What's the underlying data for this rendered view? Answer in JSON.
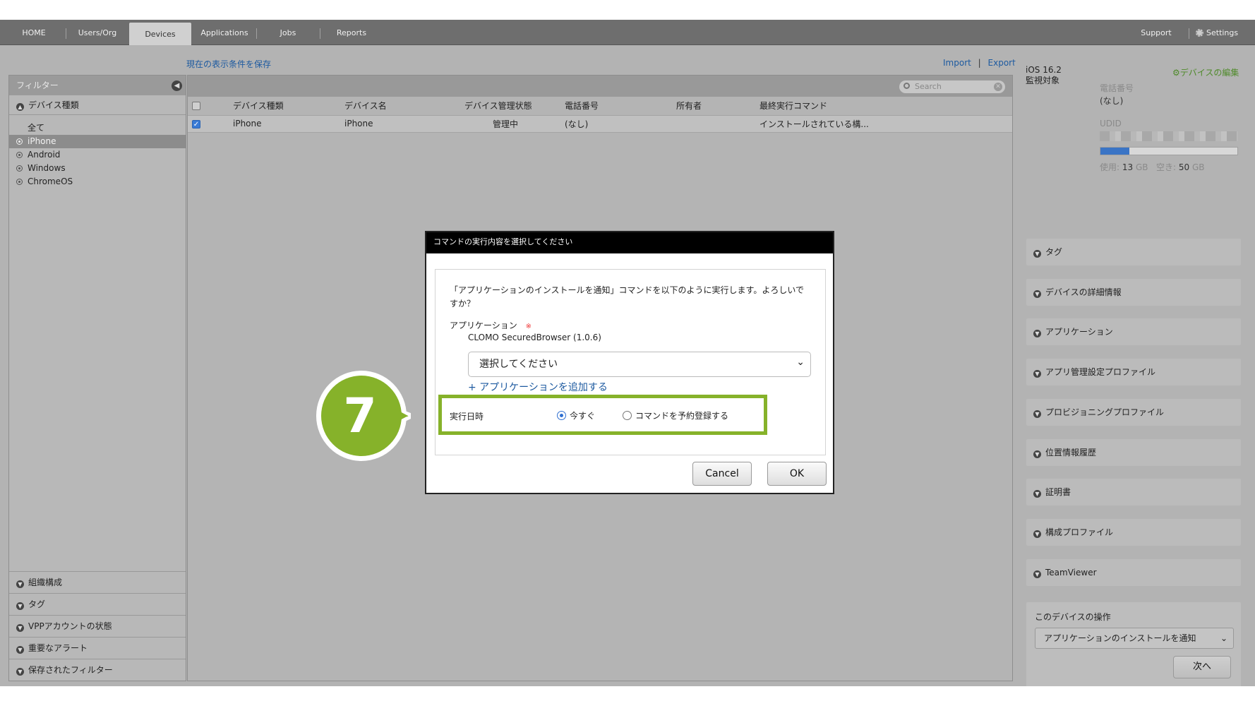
{
  "nav": {
    "tabs": [
      "HOME",
      "Users/Org",
      "Devices",
      "Applications",
      "Jobs",
      "Reports"
    ],
    "active_tab": "Devices",
    "support": "Support",
    "settings": "Settings"
  },
  "subheader": {
    "save_view": "現在の表示条件を保存",
    "import": "Import",
    "separator": "|",
    "export": "Export"
  },
  "sidebar": {
    "title": "フィルター",
    "section_device_type": "デバイス種類",
    "items": [
      "全て",
      "iPhone",
      "Android",
      "Windows",
      "ChromeOS"
    ],
    "selected_item": "iPhone",
    "bottom_sections": [
      "組織構成",
      "タグ",
      "VPPアカウントの状態",
      "重要なアラート",
      "保存されたフィルター"
    ]
  },
  "search": {
    "placeholder": "Search"
  },
  "table": {
    "columns": [
      "デバイス種類",
      "デバイス名",
      "デバイス管理状態",
      "電話番号",
      "所有者",
      "最終実行コマンド"
    ],
    "rows": [
      [
        "iPhone",
        "iPhone",
        "管理中",
        "(なし)",
        "",
        "インストールされている構..."
      ]
    ]
  },
  "right_panel": {
    "os_version": "iOS 16.2",
    "supervised": "監視対象",
    "edit_link": "デバイスの編集",
    "phone_label": "電話番号",
    "phone_value": "(なし)",
    "udid_label": "UDID",
    "storage_used_label": "使用:",
    "storage_used": "13",
    "storage_free_label": "空き:",
    "storage_free": "50",
    "storage_unit": "GB",
    "storage_used_fraction": 0.21,
    "accordions": [
      "タグ",
      "デバイスの詳細情報",
      "アプリケーション",
      "アプリ管理設定プロファイル",
      "プロビジョニングプロファイル",
      "位置情報履歴",
      "証明書",
      "構成プロファイル",
      "TeamViewer"
    ],
    "operation_title": "このデバイスの操作",
    "operation_select": "アプリケーションのインストールを通知",
    "next_button": "次へ"
  },
  "modal": {
    "title": "コマンドの実行内容を選択してください",
    "message": "「アプリケーションのインストールを通知」コマンドを以下のように実行します。よろしいですか？",
    "app_label": "アプリケーション",
    "required_mark": "※",
    "app_name": "CLOMO SecuredBrowser (1.0.6)",
    "select_placeholder": "選択してください",
    "add_app": "+ アプリケーションを追加する",
    "exec_label": "実行日時",
    "option_now": "今すぐ",
    "option_schedule": "コマンドを予約登録する",
    "cancel": "Cancel",
    "ok": "OK"
  },
  "callout": {
    "number": "7"
  },
  "colors": {
    "accent_green": "#86b22a",
    "link_blue": "#1d5aa0",
    "radio_blue": "#2f6fd1"
  }
}
